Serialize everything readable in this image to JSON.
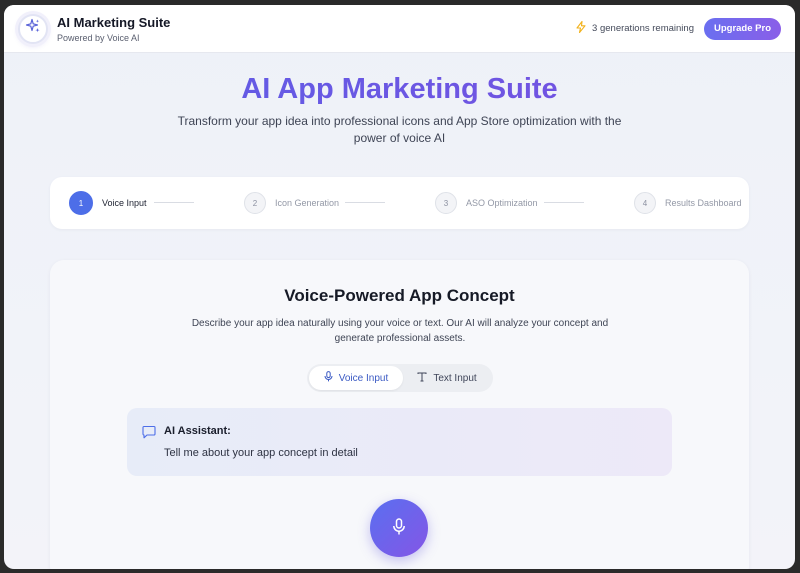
{
  "header": {
    "brand_title": "AI Marketing Suite",
    "brand_subtitle": "Powered by Voice AI",
    "generations_remaining": "3 generations remaining",
    "upgrade_label": "Upgrade Pro"
  },
  "hero": {
    "title": "AI App Marketing Suite",
    "subtitle": "Transform your app idea into professional icons and App Store optimization with the power of voice AI"
  },
  "steps": [
    {
      "number": "1",
      "label": "Voice Input",
      "active": true
    },
    {
      "number": "2",
      "label": "Icon Generation",
      "active": false
    },
    {
      "number": "3",
      "label": "ASO Optimization",
      "active": false
    },
    {
      "number": "4",
      "label": "Results Dashboard",
      "active": false
    }
  ],
  "concept": {
    "title": "Voice-Powered App Concept",
    "description": "Describe your app idea naturally using your voice or text. Our AI will analyze your concept and generate professional assets.",
    "voice_tab": "Voice Input",
    "text_tab": "Text Input",
    "assistant_title": "AI Assistant:",
    "assistant_message": "Tell me about your app concept in detail"
  },
  "icons": {
    "logo": "sparkles-icon",
    "generations": "lightning-icon",
    "voice_tab": "mic-icon",
    "text_tab": "text-type-icon",
    "assistant": "chat-bubble-icon",
    "record": "mic-icon"
  },
  "colors": {
    "accent_blue": "#4d6ee8",
    "accent_purple": "#8a5ee8",
    "lightning": "#f2b21c"
  }
}
